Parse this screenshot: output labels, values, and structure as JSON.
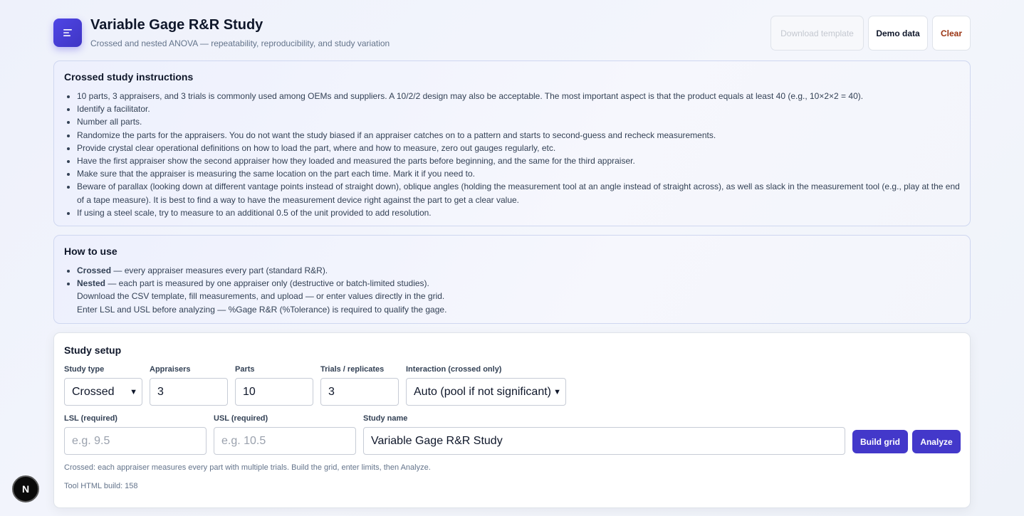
{
  "header": {
    "title": "Variable Gage R&R Study",
    "subtitle": "Crossed and nested ANOVA — repeatability, reproducibility, and study variation",
    "download_template": "Download template",
    "demo_data": "Demo data",
    "clear": "Clear",
    "logo_icon": "menu-lines-icon"
  },
  "instructions": {
    "title": "Crossed study instructions",
    "items": [
      "10 parts, 3 appraisers, and 3 trials is commonly used among OEMs and suppliers. A 10/2/2 design may also be acceptable. The most important aspect is that the product equals at least 40 (e.g., 10×2×2 = 40).",
      "Identify a facilitator.",
      "Number all parts.",
      "Randomize the parts for the appraisers. You do not want the study biased if an appraiser catches on to a pattern and starts to second-guess and recheck measurements.",
      "Provide crystal clear operational definitions on how to load the part, where and how to measure, zero out gauges regularly, etc.",
      "Have the first appraiser show the second appraiser how they loaded and measured the parts before beginning, and the same for the third appraiser.",
      "Make sure that the appraiser is measuring the same location on the part each time. Mark it if you need to.",
      "Beware of parallax (looking down at different vantage points instead of straight down), oblique angles (holding the measurement tool at an angle instead of straight across), as well as slack in the measurement tool (e.g., play at the end of a tape measure). It is best to find a way to have the measurement device right against the part to get a clear value.",
      "If using a steel scale, try to measure to an additional 0.5 of the unit provided to add resolution."
    ]
  },
  "howto": {
    "title": "How to use",
    "crossed_term": "Crossed",
    "crossed_text": " — every appraiser measures every part (standard R&R).",
    "nested_term": "Nested",
    "nested_text": " — each part is measured by one appraiser only (destructive or batch-limited studies).",
    "line_csv": "Download the CSV template, fill measurements, and upload — or enter values directly in the grid.",
    "line_limits": "Enter LSL and USL before analyzing — %Gage R&R (%Tolerance) is required to qualify the gage."
  },
  "setup": {
    "title": "Study setup",
    "study_type_label": "Study type",
    "study_type_value": "Crossed",
    "appraisers_label": "Appraisers",
    "appraisers_value": "3",
    "parts_label": "Parts",
    "parts_value": "10",
    "trials_label": "Trials / replicates",
    "trials_value": "3",
    "interaction_label": "Interaction (crossed only)",
    "interaction_value": "Auto (pool if not significant)",
    "lsl_label": "LSL (required)",
    "lsl_placeholder": "e.g. 9.5",
    "usl_label": "USL (required)",
    "usl_placeholder": "e.g. 10.5",
    "study_name_label": "Study name",
    "study_name_value": "Variable Gage R&R Study",
    "build_grid": "Build grid",
    "analyze": "Analyze",
    "hint": "Crossed: each appraiser measures every part with multiple trials. Build the grid, enter limits, then Analyze.",
    "build_info": "Tool HTML build: 158"
  },
  "badge": {
    "letter": "N"
  }
}
